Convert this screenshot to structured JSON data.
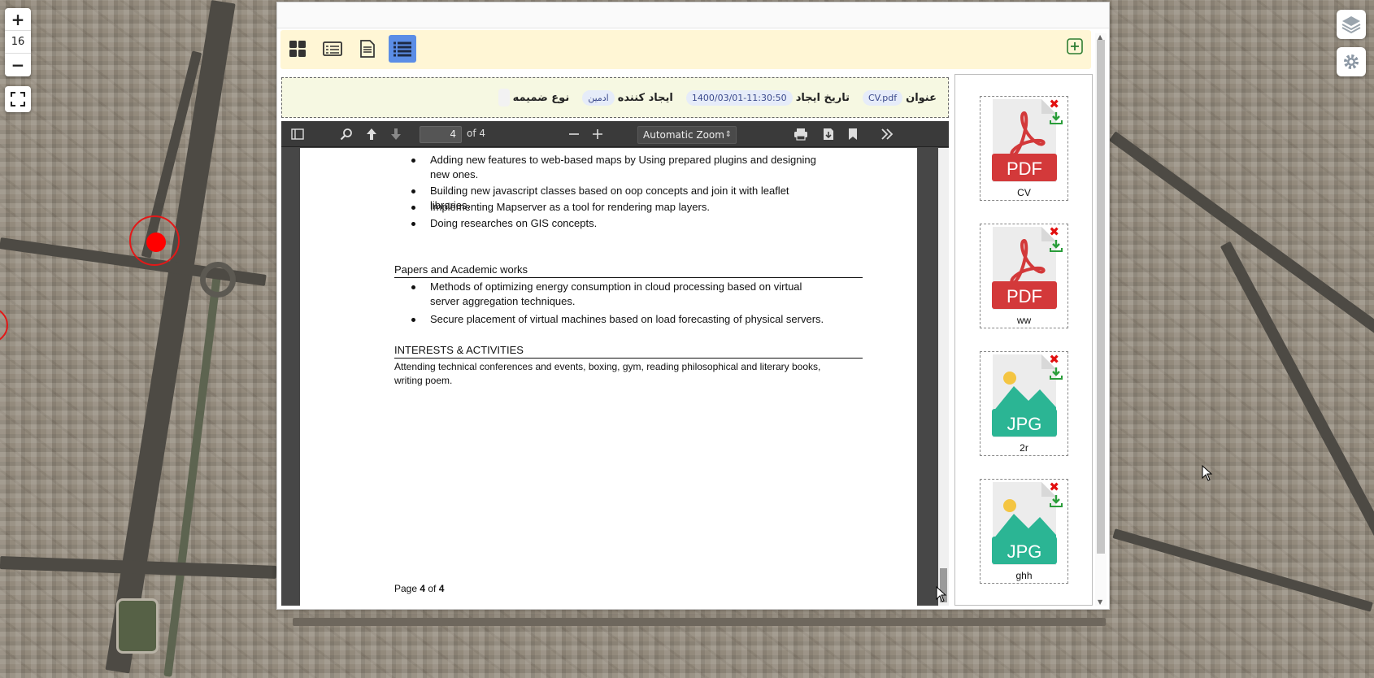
{
  "map": {
    "zoom_in": "+",
    "zoom_level": "16",
    "zoom_out": "−"
  },
  "toolbar": {
    "views": [
      "grid-view",
      "list-view",
      "document-view",
      "details-view"
    ],
    "active_view": "details-view"
  },
  "meta": {
    "title_label": "عنوان",
    "title_value": "CV.pdf",
    "created_date_label": "تاریخ ایجاد",
    "created_date_value": "1400/03/01-11:30:50",
    "creator_label": "ایجاد کننده",
    "creator_value": "ادمین",
    "attachment_type_label": "نوع ضمیمه",
    "attachment_type_value": ""
  },
  "viewer": {
    "page_number": "4",
    "of_pages": "of 4",
    "zoom": "Automatic Zoom"
  },
  "document": {
    "bullets_top": [
      "Adding new features to web-based maps by Using prepared plugins and designing new ones.",
      "Building new javascript classes based on oop concepts and join it with leaflet libraries.",
      "Implementing Mapserver as a tool for rendering map layers.",
      "Doing researches on GIS concepts."
    ],
    "papers_heading": "Papers and Academic works",
    "papers": [
      "Methods of optimizing energy consumption in cloud processing based on virtual server aggregation techniques.",
      "Secure placement of virtual machines based on load forecasting of physical servers."
    ],
    "interests_heading": "INTERESTS & ACTIVITIES",
    "interests_text": "Attending technical conferences and events, boxing, gym, reading philosophical and literary books, writing poem.",
    "footer_prefix": "Page ",
    "footer_current": "4",
    "footer_middle": " of ",
    "footer_total": "4"
  },
  "attachments": [
    {
      "type_label": "PDF",
      "name": "CV",
      "kind": "pdf"
    },
    {
      "type_label": "PDF",
      "name": "ww",
      "kind": "pdf"
    },
    {
      "type_label": "JPG",
      "name": "2r",
      "kind": "jpg"
    },
    {
      "type_label": "JPG",
      "name": "ghh",
      "kind": "jpg"
    }
  ],
  "colors": {
    "toolbar_bg": "#fff6d5",
    "active_view": "#5b8de6",
    "pdf_red": "#d3393a",
    "jpg_teal": "#2bb594",
    "delete": "#e21010",
    "download": "#2a9d3a"
  }
}
